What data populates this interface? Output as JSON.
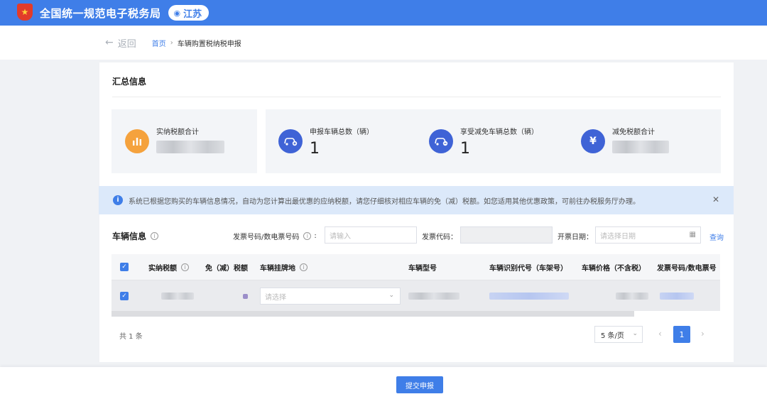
{
  "header": {
    "site_title": "全国统一规范电子税务局",
    "region": "江苏",
    "colors": {
      "brand": "#3f7ee8",
      "emblem": "#e23b2a"
    }
  },
  "breadcrumb": {
    "back_label": "返回",
    "home": "首页",
    "current": "车辆购置税纳税申报"
  },
  "summary": {
    "title": "汇总信息",
    "stats": [
      {
        "label": "实纳税额合计",
        "value": "",
        "icon": "bar-chart-icon"
      },
      {
        "label": "申报车辆总数（辆）",
        "value": "1",
        "icon": "car-add-icon"
      },
      {
        "label": "享受减免车辆总数（辆）",
        "value": "1",
        "icon": "car-minus-icon"
      },
      {
        "label": "减免税额合计",
        "value": "",
        "icon": "yen-cycle-icon"
      }
    ]
  },
  "notice": {
    "text": "系统已根据您购买的车辆信息情况，自动为您计算出最优惠的应纳税额，请您仔细核对相应车辆的免（减）税额。如您适用其他优惠政策，可前往办税服务厅办理。"
  },
  "vehicle": {
    "title": "车辆信息",
    "filters": {
      "invoice_no_label": "发票号码/数电票号码",
      "invoice_no_placeholder": "请输入",
      "invoice_code_label": "发票代码：",
      "issue_date_label": "开票日期：",
      "issue_date_placeholder": "请选择日期",
      "query_label": "查询"
    },
    "columns": [
      "实纳税额",
      "免（减）税额",
      "车辆挂牌地",
      "车辆型号",
      "车辆识别代号（车架号）",
      "车辆价格（不含税）",
      "发票号码/数电票号"
    ],
    "row": {
      "plate_placeholder": "请选择"
    }
  },
  "pagination": {
    "total": "共 1 条",
    "page_size": "5 条/页",
    "current_page": "1"
  },
  "footer": {
    "submit_label": "提交申报"
  }
}
